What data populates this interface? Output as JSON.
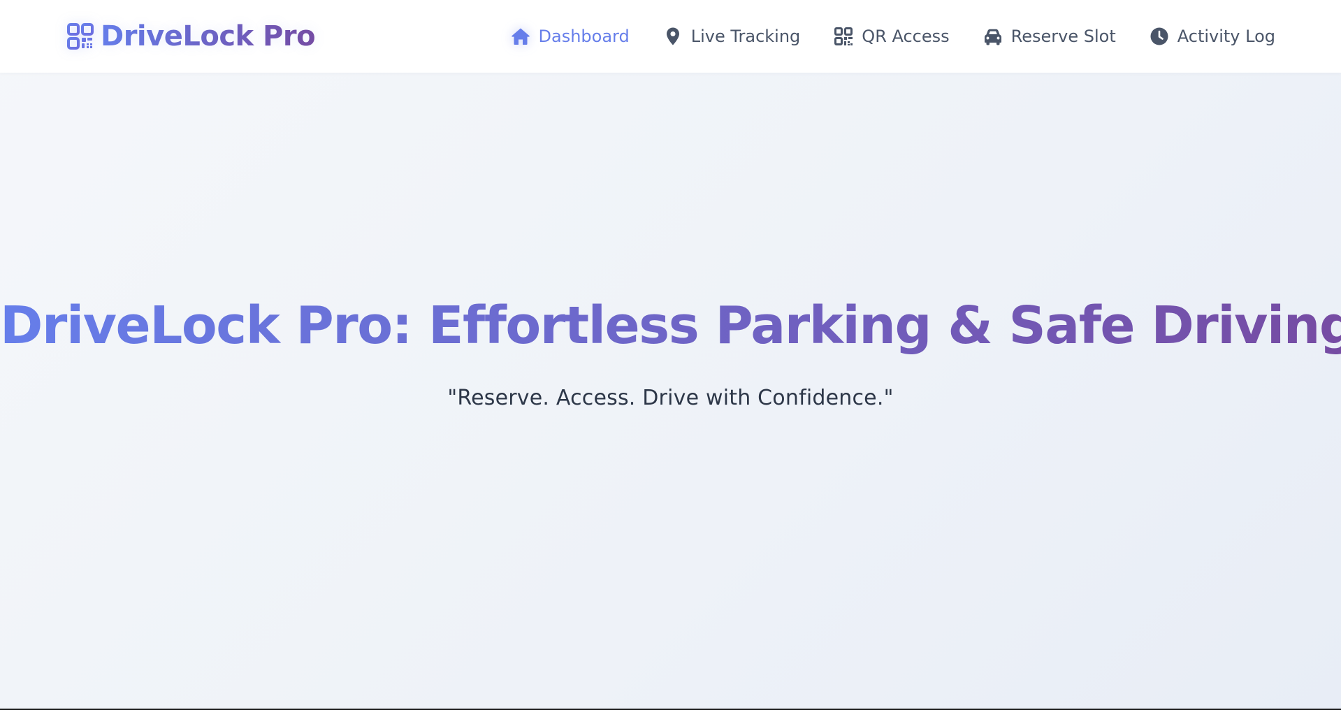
{
  "brand": {
    "name": "DriveLock Pro",
    "icon": "qrcode-icon"
  },
  "nav": {
    "items": [
      {
        "label": "Dashboard",
        "icon": "home-icon",
        "active": true
      },
      {
        "label": "Live Tracking",
        "icon": "map-pin-icon",
        "active": false
      },
      {
        "label": "QR Access",
        "icon": "qrcode-icon",
        "active": false
      },
      {
        "label": "Reserve Slot",
        "icon": "car-icon",
        "active": false
      },
      {
        "label": "Activity Log",
        "icon": "clock-icon",
        "active": false
      }
    ]
  },
  "hero": {
    "title": "DriveLock Pro: Effortless Parking & Safe Driving",
    "tagline": "\"Reserve. Access. Drive with Confidence.\""
  },
  "colors": {
    "accent_start": "#667eea",
    "accent_end": "#764ba2",
    "nav_text": "#4a5568",
    "tagline_text": "#2d3748",
    "background": "#f1f4f9"
  }
}
